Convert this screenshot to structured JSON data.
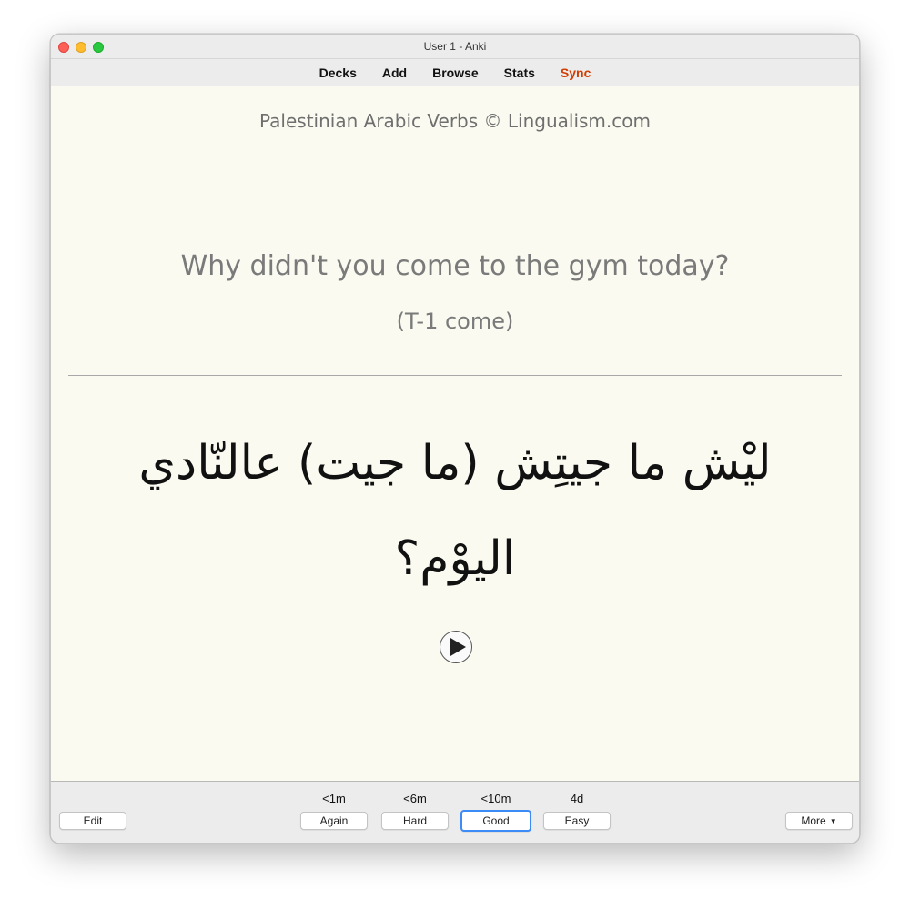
{
  "window": {
    "title": "User 1 - Anki"
  },
  "toolbar": {
    "decks": "Decks",
    "add": "Add",
    "browse": "Browse",
    "stats": "Stats",
    "sync": "Sync"
  },
  "card": {
    "deck_credit": "Palestinian Arabic Verbs © Lingualism.com",
    "question": "Why didn't you come to the gym today?",
    "hint": "(T-1 come)",
    "answer": "ليْش ما جيتِش (ما جيت) عالنّادي اليوْم؟",
    "play_icon": "play-icon"
  },
  "bottom": {
    "edit": "Edit",
    "more": "More",
    "more_caret": "▼",
    "answers": [
      {
        "label": "Again",
        "interval": "<1m"
      },
      {
        "label": "Hard",
        "interval": "<6m"
      },
      {
        "label": "Good",
        "interval": "<10m"
      },
      {
        "label": "Easy",
        "interval": "4d"
      }
    ]
  },
  "colors": {
    "card_background": "#fafaf0",
    "sync_accent": "#d23c00",
    "focus_ring": "#3d8bf7"
  }
}
